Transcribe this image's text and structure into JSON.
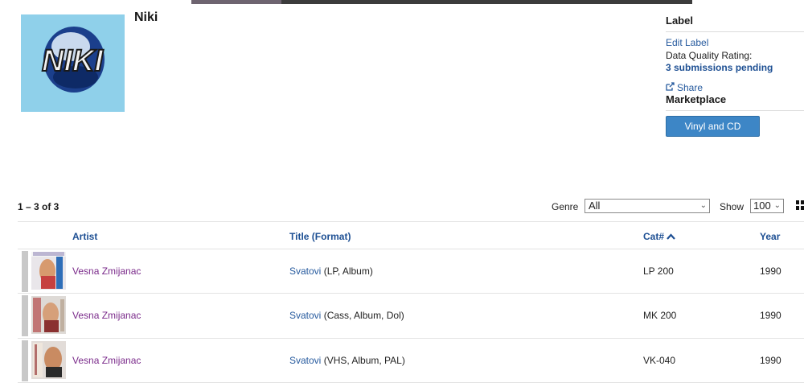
{
  "label": {
    "name": "Niki",
    "logo_text": "NIKI"
  },
  "sidebar": {
    "label_heading": "Label",
    "edit_label": "Edit Label",
    "data_quality": "Data Quality Rating:",
    "submissions_pending": "3 submissions pending",
    "share": "Share",
    "marketplace_heading": "Marketplace",
    "vinyl_cd_button": "Vinyl and CD"
  },
  "list": {
    "count": "1 – 3 of 3",
    "genre_label": "Genre",
    "genre_value": "All",
    "show_label": "Show",
    "show_value": "100",
    "columns": {
      "artist": "Artist",
      "title": "Title (Format)",
      "cat": "Cat#",
      "year": "Year"
    },
    "rows": [
      {
        "artist": "Vesna Zmijanac",
        "title": "Svatovi",
        "format": "(LP, Album)",
        "cat": "LP 200",
        "year": "1990"
      },
      {
        "artist": "Vesna Zmijanac",
        "title": "Svatovi",
        "format": "(Cass, Album, Dol)",
        "cat": "MK 200",
        "year": "1990"
      },
      {
        "artist": "Vesna Zmijanac",
        "title": "Svatovi",
        "format": "(VHS, Album, PAL)",
        "cat": "VK-040",
        "year": "1990"
      }
    ]
  },
  "icons": {
    "share": "share-icon",
    "sort": "sort-ascending-icon",
    "view_toggle": "grid-view-icon"
  },
  "colors": {
    "link": "#265a9e",
    "artist_link": "#7a2a8a",
    "button": "#3d86c6"
  }
}
